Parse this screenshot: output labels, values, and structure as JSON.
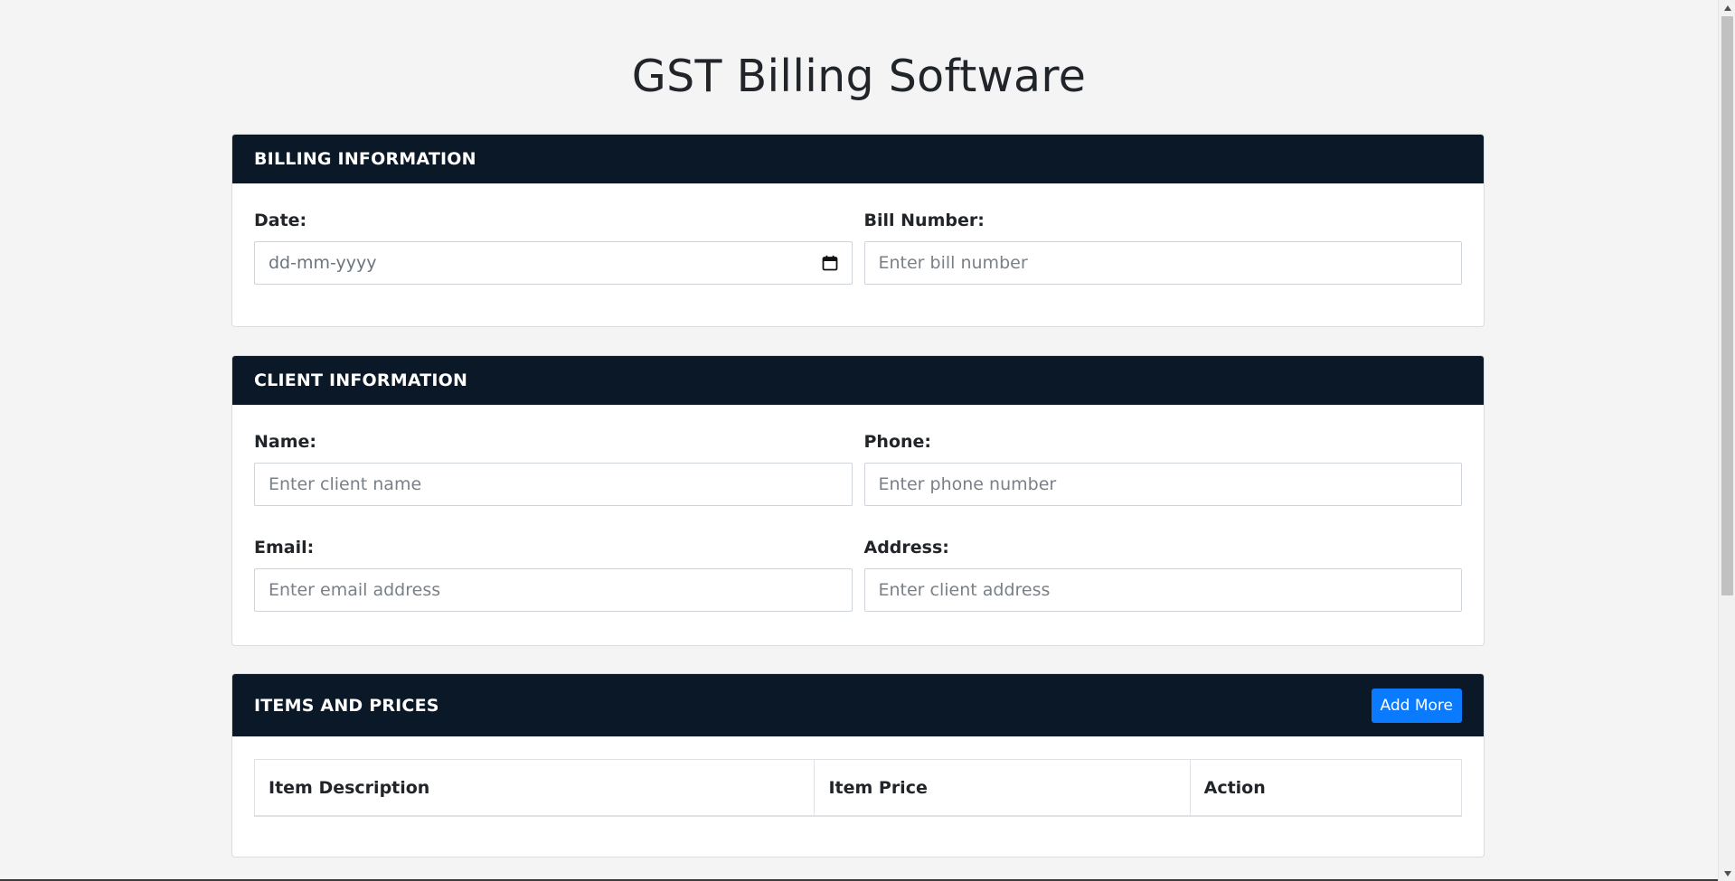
{
  "app": {
    "title": "GST Billing Software"
  },
  "billing": {
    "header": "BILLING INFORMATION",
    "date_label": "Date:",
    "date_placeholder": "dd-mm-yyyy",
    "bill_label": "Bill Number:",
    "bill_placeholder": "Enter bill number"
  },
  "client": {
    "header": "CLIENT INFORMATION",
    "name_label": "Name:",
    "name_placeholder": "Enter client name",
    "phone_label": "Phone:",
    "phone_placeholder": "Enter phone number",
    "email_label": "Email:",
    "email_placeholder": "Enter email address",
    "address_label": "Address:",
    "address_placeholder": "Enter client address"
  },
  "items": {
    "header": "ITEMS AND PRICES",
    "add_button": "Add More",
    "columns": [
      "Item Description",
      "Item Price",
      "Action"
    ]
  },
  "colors": {
    "header_bg": "#0b1827",
    "accent": "#0a7bff",
    "page_bg": "#f4f4f4"
  },
  "icons": {
    "date_picker": "calendar-icon"
  }
}
